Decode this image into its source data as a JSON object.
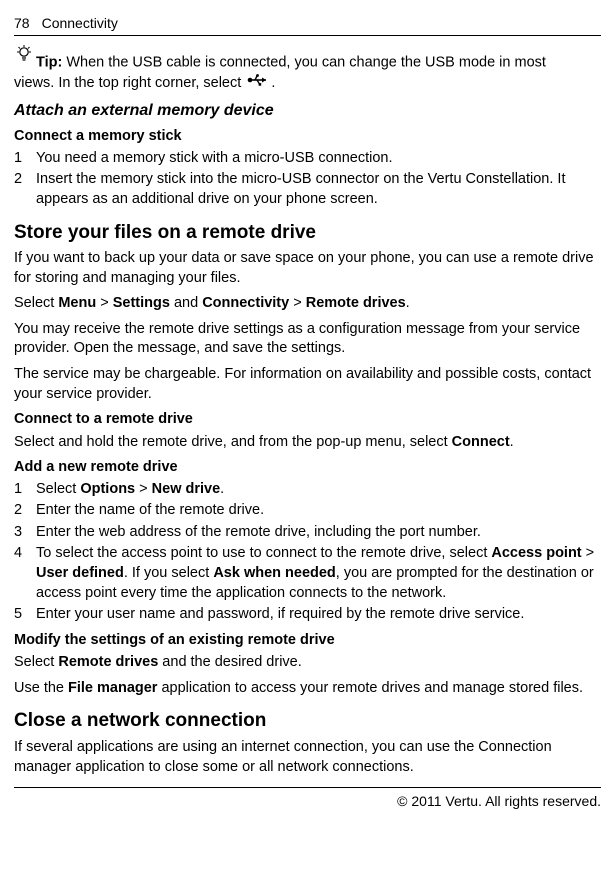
{
  "header": {
    "page_number": "78",
    "section": "Connectivity"
  },
  "tip": {
    "label": "Tip:",
    "line1": " When the USB cable is connected, you can change the USB mode in most",
    "line2": "views. In the top right corner, select ",
    "line2_tail": "."
  },
  "attach": {
    "heading": "Attach an external memory device",
    "sub": "Connect a memory stick",
    "steps": [
      "You need a memory stick with a micro-USB connection.",
      "Insert the memory stick into the micro-USB connector on the Vertu Constellation. It appears as an additional drive on your phone screen."
    ]
  },
  "store": {
    "heading": "Store your files on a remote drive",
    "p1": "If you want to back up your data or save space on your phone, you can use a remote drive for storing and managing your files.",
    "nav_prefix": "Select ",
    "nav_menu": "Menu",
    "nav_gt1": " > ",
    "nav_settings": "Settings",
    "nav_and": " and ",
    "nav_conn": "Connectivity",
    "nav_gt2": " > ",
    "nav_remote": "Remote drives",
    "nav_period": ".",
    "p2": "You may receive the remote drive settings as a configuration message from your service provider. Open the message, and save the settings.",
    "p3": "The service may be chargeable. For information on availability and possible costs, contact your service provider."
  },
  "connect": {
    "heading": "Connect to a remote drive",
    "line_pre": "Select and hold the remote drive, and from the pop-up menu, select ",
    "connect_word": "Connect",
    "line_post": "."
  },
  "add": {
    "heading": "Add a new remote drive",
    "step1_pre": "Select ",
    "step1_opt": "Options",
    "step1_gt": " > ",
    "step1_new": "New drive",
    "step1_post": ".",
    "step2": "Enter the name of the remote drive.",
    "step3": "Enter the web address of the remote drive, including the port number.",
    "step4_pre": "To select the access point to use to connect to the remote drive, select ",
    "step4_ap": "Access point",
    "step4_gt": " > ",
    "step4_ud": "User defined",
    "step4_mid": ". If you select ",
    "step4_ask": "Ask when needed",
    "step4_post": ", you are prompted for the destination or access point every time the application connects to the network.",
    "step5": "Enter your user name and password, if required by the remote drive service."
  },
  "modify": {
    "heading": "Modify the settings of an existing remote drive",
    "line_pre": "Select ",
    "line_rd": "Remote drives",
    "line_post": " and the desired drive.",
    "fm_pre": "Use the ",
    "fm": "File manager",
    "fm_post": " application to access your remote drives and manage stored files."
  },
  "close": {
    "heading": "Close a network connection",
    "p1": "If several applications are using an internet connection, you can use the Connection manager application to close some or all network connections."
  },
  "footer": {
    "copyright": "© 2011 Vertu. All rights reserved."
  },
  "nums": {
    "1": "1",
    "2": "2",
    "3": "3",
    "4": "4",
    "5": "5"
  }
}
